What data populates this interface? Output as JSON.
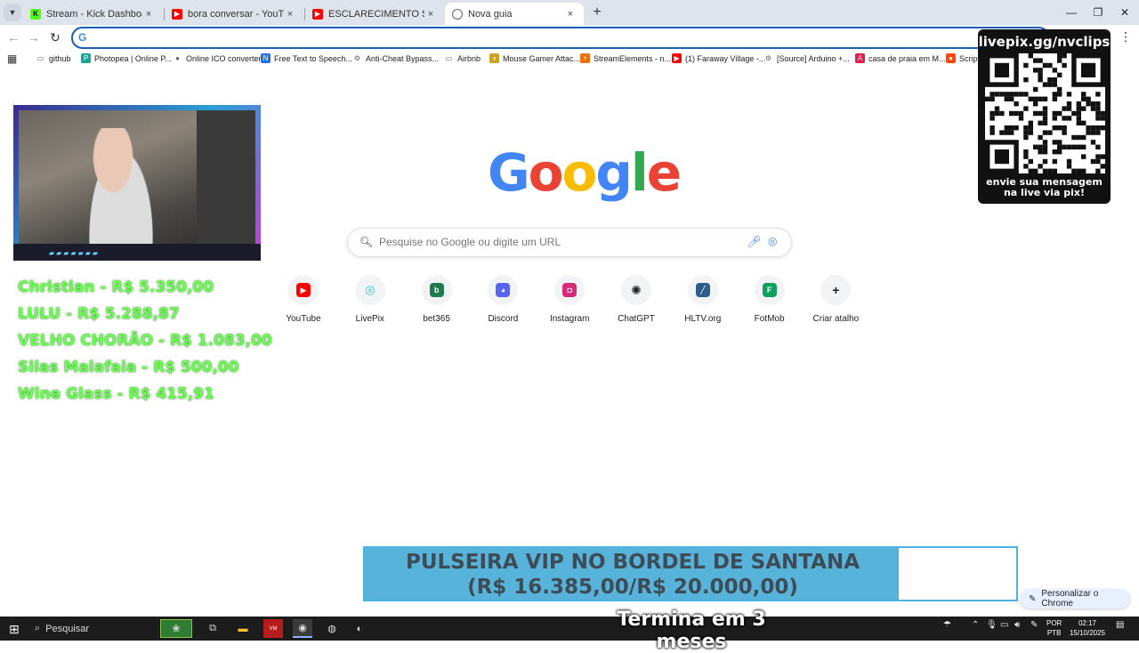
{
  "tabs": [
    {
      "title": "Stream - Kick Dashboard",
      "icon": "kick-icon",
      "color": "#53fc18"
    },
    {
      "title": "bora conversar - YouTube",
      "icon": "youtube-icon",
      "color": "#ff0000"
    },
    {
      "title": "ESCLARECIMENTO SOS SOBRE",
      "icon": "youtube-icon",
      "color": "#ff0000"
    },
    {
      "title": "Nova guia",
      "icon": "chrome-icon",
      "color": "#5f6368"
    }
  ],
  "tab_close": "×",
  "new_tab": "+",
  "omnibox": {
    "value": "",
    "placeholder": ""
  },
  "bookmarks": [
    {
      "label": "github",
      "icon": "folder-icon",
      "color": "#5f6368"
    },
    {
      "label": "Photopea | Online P...",
      "icon": "photopea-icon",
      "color": "#18a497"
    },
    {
      "label": "Online ICO converter",
      "icon": "globe-icon",
      "color": "#5f6368"
    },
    {
      "label": "Free Text to Speech...",
      "icon": "tts-icon",
      "color": "#1a73e8"
    },
    {
      "label": "Anti-Cheat Bypass...",
      "icon": "script-icon",
      "color": "#5f6368"
    },
    {
      "label": "Airbnb",
      "icon": "folder-icon",
      "color": "#5f6368"
    },
    {
      "label": "Mouse Gamer Attac...",
      "icon": "mouse-icon",
      "color": "#c9a227"
    },
    {
      "label": "StreamElements - n...",
      "icon": "streamelements-icon",
      "color": "#e8710a"
    },
    {
      "label": "(1) Faraway Village -...",
      "icon": "youtube-icon",
      "color": "#ff0000"
    },
    {
      "label": "[Source] Arduino +...",
      "icon": "script-icon",
      "color": "#5f6368"
    },
    {
      "label": "casa de praia em M...",
      "icon": "airbnb-icon",
      "color": "#e61e4d"
    },
    {
      "label": "Script",
      "icon": "reddit-icon",
      "color": "#ff4500"
    }
  ],
  "donors": [
    "Christian - R$ 5.350,00",
    "LULU - R$ 5.288,87",
    "VELHO CHORÃO - R$ 1.083,00",
    "Silas Malafaia - R$ 500,00",
    "Wine Glass - R$ 415,91"
  ],
  "google": {
    "logo_letters": [
      {
        "ch": "G",
        "color": "#4285f4"
      },
      {
        "ch": "o",
        "color": "#ea4335"
      },
      {
        "ch": "o",
        "color": "#fbbc05"
      },
      {
        "ch": "g",
        "color": "#4285f4"
      },
      {
        "ch": "l",
        "color": "#34a853"
      },
      {
        "ch": "e",
        "color": "#ea4335"
      }
    ],
    "search_placeholder": "Pesquise no Google ou digite um URL"
  },
  "shortcuts": [
    {
      "label": "YouTube",
      "icon": "youtube-icon",
      "color": "#ff0000"
    },
    {
      "label": "LivePix",
      "icon": "livepix-icon",
      "color": "#28c7c0"
    },
    {
      "label": "bet365",
      "icon": "bet365-icon",
      "color": "#1f7a4d"
    },
    {
      "label": "Discord",
      "icon": "discord-icon",
      "color": "#5865f2"
    },
    {
      "label": "Instagram",
      "icon": "instagram-icon",
      "color": "#d62976"
    },
    {
      "label": "ChatGPT",
      "icon": "chatgpt-icon",
      "color": "#202124"
    },
    {
      "label": "HLTV.org",
      "icon": "hltv-icon",
      "color": "#2b5c8a"
    },
    {
      "label": "FotMob",
      "icon": "fotmob-icon",
      "color": "#0ea05f"
    },
    {
      "label": "Criar atalho",
      "icon": "plus-icon",
      "color": "#202124"
    }
  ],
  "qr_panel": {
    "url": "livepix.gg/nvclips",
    "cta": "envie sua mensagem na live via pix!"
  },
  "goal": {
    "title": "PULSEIRA VIP NO BORDEL DE SANTANA",
    "amount": "(R$ 16.385,00/R$ 20.000,00)",
    "current": 16385,
    "target": 20000,
    "ends": "Termina em 3 meses"
  },
  "customize_label": "Personalizar o Chrome",
  "taskbar": {
    "search_label": "Pesquisar",
    "lang": [
      "POR",
      "PTB"
    ],
    "time": "02:17",
    "date": "15/10/2025"
  }
}
